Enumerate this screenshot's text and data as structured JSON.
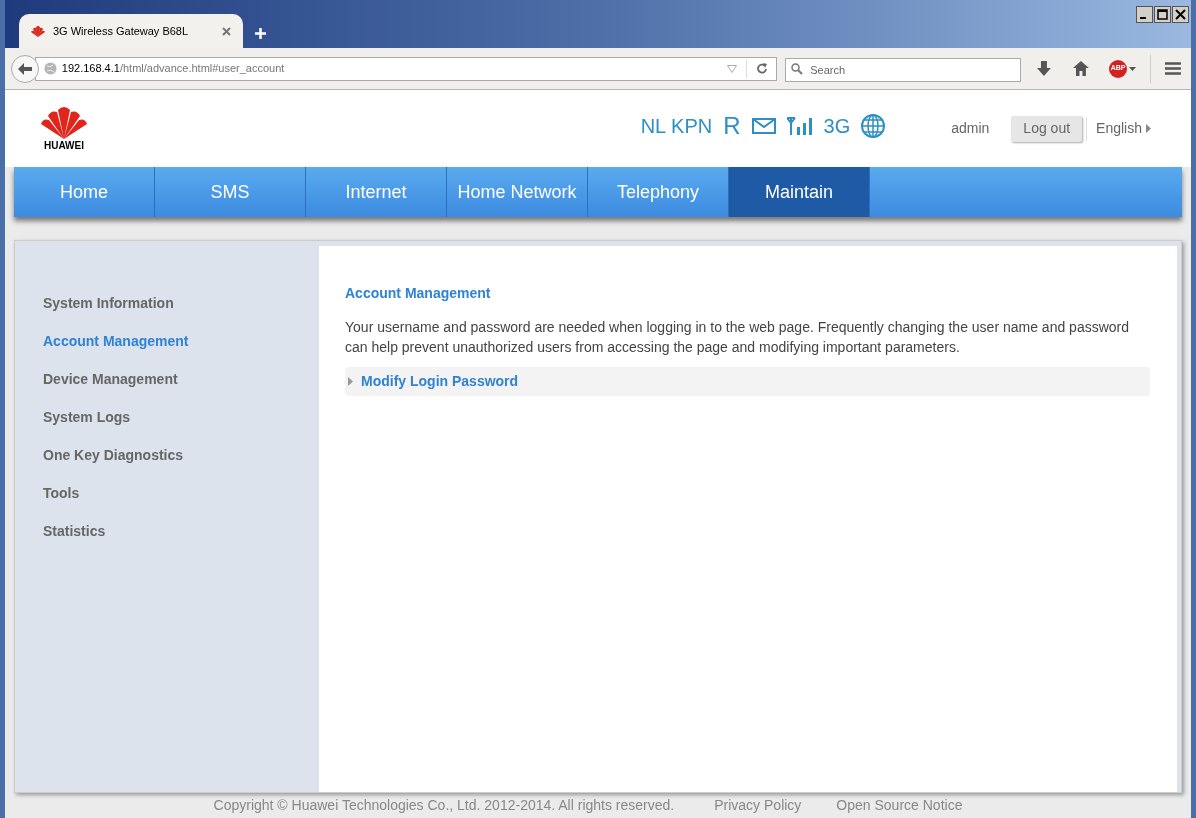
{
  "browser": {
    "tab_title": "3G Wireless Gateway B68L",
    "url_host": "192.168.4.1",
    "url_path": "/html/advance.html#user_account",
    "search": {
      "placeholder": "Search"
    },
    "adblock_label": "ABP"
  },
  "header": {
    "logo_text": "HUAWEI",
    "operator": "NL KPN",
    "roaming": "R",
    "network_type": "3G",
    "user": "admin",
    "logout": "Log out",
    "language": "English"
  },
  "nav": [
    {
      "label": "Home",
      "selected": false
    },
    {
      "label": "SMS",
      "selected": false
    },
    {
      "label": "Internet",
      "selected": false
    },
    {
      "label": "Home Network",
      "selected": false
    },
    {
      "label": "Telephony",
      "selected": false
    },
    {
      "label": "Maintain",
      "selected": true
    }
  ],
  "sidebar": {
    "items": [
      {
        "label": "System Information",
        "selected": false
      },
      {
        "label": "Account Management",
        "selected": true
      },
      {
        "label": "Device Management",
        "selected": false
      },
      {
        "label": "System Logs",
        "selected": false
      },
      {
        "label": "One Key Diagnostics",
        "selected": false
      },
      {
        "label": "Tools",
        "selected": false
      },
      {
        "label": "Statistics",
        "selected": false
      }
    ]
  },
  "content": {
    "title": "Account Management",
    "description": "Your username and password are needed when logging in to the web page. Frequently changing the user name and password can help prevent unauthorized users from accessing the page and modifying important parameters.",
    "sections": [
      {
        "label": "Modify Login Password",
        "expanded": false
      }
    ]
  },
  "footer": {
    "copyright": "Copyright © Huawei Technologies Co., Ltd. 2012-2014. All rights reserved.",
    "links": [
      "Privacy Policy",
      "Open Source Notice"
    ]
  }
}
